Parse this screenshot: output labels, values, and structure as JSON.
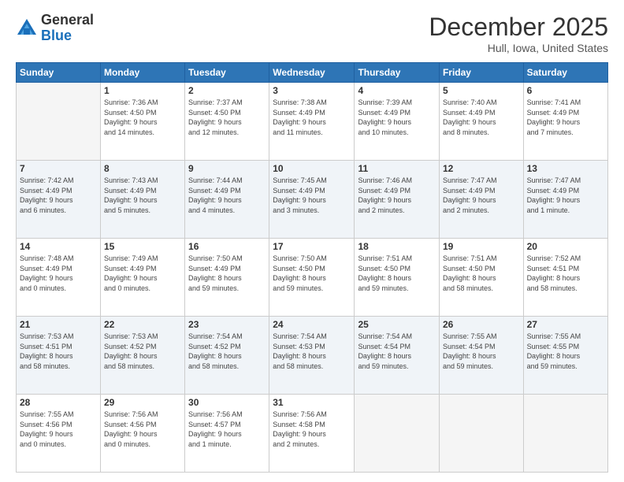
{
  "logo": {
    "general": "General",
    "blue": "Blue"
  },
  "header": {
    "month": "December 2025",
    "location": "Hull, Iowa, United States"
  },
  "days_of_week": [
    "Sunday",
    "Monday",
    "Tuesday",
    "Wednesday",
    "Thursday",
    "Friday",
    "Saturday"
  ],
  "weeks": [
    [
      {
        "day": "",
        "info": ""
      },
      {
        "day": "1",
        "info": "Sunrise: 7:36 AM\nSunset: 4:50 PM\nDaylight: 9 hours\nand 14 minutes."
      },
      {
        "day": "2",
        "info": "Sunrise: 7:37 AM\nSunset: 4:50 PM\nDaylight: 9 hours\nand 12 minutes."
      },
      {
        "day": "3",
        "info": "Sunrise: 7:38 AM\nSunset: 4:49 PM\nDaylight: 9 hours\nand 11 minutes."
      },
      {
        "day": "4",
        "info": "Sunrise: 7:39 AM\nSunset: 4:49 PM\nDaylight: 9 hours\nand 10 minutes."
      },
      {
        "day": "5",
        "info": "Sunrise: 7:40 AM\nSunset: 4:49 PM\nDaylight: 9 hours\nand 8 minutes."
      },
      {
        "day": "6",
        "info": "Sunrise: 7:41 AM\nSunset: 4:49 PM\nDaylight: 9 hours\nand 7 minutes."
      }
    ],
    [
      {
        "day": "7",
        "info": "Sunrise: 7:42 AM\nSunset: 4:49 PM\nDaylight: 9 hours\nand 6 minutes."
      },
      {
        "day": "8",
        "info": "Sunrise: 7:43 AM\nSunset: 4:49 PM\nDaylight: 9 hours\nand 5 minutes."
      },
      {
        "day": "9",
        "info": "Sunrise: 7:44 AM\nSunset: 4:49 PM\nDaylight: 9 hours\nand 4 minutes."
      },
      {
        "day": "10",
        "info": "Sunrise: 7:45 AM\nSunset: 4:49 PM\nDaylight: 9 hours\nand 3 minutes."
      },
      {
        "day": "11",
        "info": "Sunrise: 7:46 AM\nSunset: 4:49 PM\nDaylight: 9 hours\nand 2 minutes."
      },
      {
        "day": "12",
        "info": "Sunrise: 7:47 AM\nSunset: 4:49 PM\nDaylight: 9 hours\nand 2 minutes."
      },
      {
        "day": "13",
        "info": "Sunrise: 7:47 AM\nSunset: 4:49 PM\nDaylight: 9 hours\nand 1 minute."
      }
    ],
    [
      {
        "day": "14",
        "info": "Sunrise: 7:48 AM\nSunset: 4:49 PM\nDaylight: 9 hours\nand 0 minutes."
      },
      {
        "day": "15",
        "info": "Sunrise: 7:49 AM\nSunset: 4:49 PM\nDaylight: 9 hours\nand 0 minutes."
      },
      {
        "day": "16",
        "info": "Sunrise: 7:50 AM\nSunset: 4:49 PM\nDaylight: 8 hours\nand 59 minutes."
      },
      {
        "day": "17",
        "info": "Sunrise: 7:50 AM\nSunset: 4:50 PM\nDaylight: 8 hours\nand 59 minutes."
      },
      {
        "day": "18",
        "info": "Sunrise: 7:51 AM\nSunset: 4:50 PM\nDaylight: 8 hours\nand 59 minutes."
      },
      {
        "day": "19",
        "info": "Sunrise: 7:51 AM\nSunset: 4:50 PM\nDaylight: 8 hours\nand 58 minutes."
      },
      {
        "day": "20",
        "info": "Sunrise: 7:52 AM\nSunset: 4:51 PM\nDaylight: 8 hours\nand 58 minutes."
      }
    ],
    [
      {
        "day": "21",
        "info": "Sunrise: 7:53 AM\nSunset: 4:51 PM\nDaylight: 8 hours\nand 58 minutes."
      },
      {
        "day": "22",
        "info": "Sunrise: 7:53 AM\nSunset: 4:52 PM\nDaylight: 8 hours\nand 58 minutes."
      },
      {
        "day": "23",
        "info": "Sunrise: 7:54 AM\nSunset: 4:52 PM\nDaylight: 8 hours\nand 58 minutes."
      },
      {
        "day": "24",
        "info": "Sunrise: 7:54 AM\nSunset: 4:53 PM\nDaylight: 8 hours\nand 58 minutes."
      },
      {
        "day": "25",
        "info": "Sunrise: 7:54 AM\nSunset: 4:54 PM\nDaylight: 8 hours\nand 59 minutes."
      },
      {
        "day": "26",
        "info": "Sunrise: 7:55 AM\nSunset: 4:54 PM\nDaylight: 8 hours\nand 59 minutes."
      },
      {
        "day": "27",
        "info": "Sunrise: 7:55 AM\nSunset: 4:55 PM\nDaylight: 8 hours\nand 59 minutes."
      }
    ],
    [
      {
        "day": "28",
        "info": "Sunrise: 7:55 AM\nSunset: 4:56 PM\nDaylight: 9 hours\nand 0 minutes."
      },
      {
        "day": "29",
        "info": "Sunrise: 7:56 AM\nSunset: 4:56 PM\nDaylight: 9 hours\nand 0 minutes."
      },
      {
        "day": "30",
        "info": "Sunrise: 7:56 AM\nSunset: 4:57 PM\nDaylight: 9 hours\nand 1 minute."
      },
      {
        "day": "31",
        "info": "Sunrise: 7:56 AM\nSunset: 4:58 PM\nDaylight: 9 hours\nand 2 minutes."
      },
      {
        "day": "",
        "info": ""
      },
      {
        "day": "",
        "info": ""
      },
      {
        "day": "",
        "info": ""
      }
    ]
  ]
}
